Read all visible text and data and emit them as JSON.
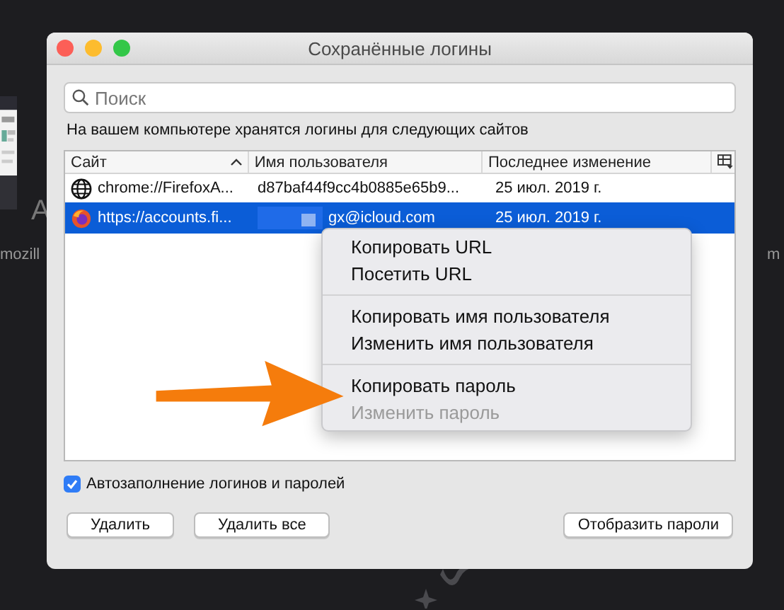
{
  "background": {
    "letter": "A",
    "left_label": "mozill",
    "right_label": "m"
  },
  "window": {
    "title": "Сохранённые логины"
  },
  "search": {
    "placeholder": "Поиск"
  },
  "info_text": "На вашем компьютере хранятся логины для следующих сайтов",
  "table": {
    "columns": [
      {
        "label": "Сайт",
        "sorted": true
      },
      {
        "label": "Имя пользователя",
        "sorted": false
      },
      {
        "label": "Последнее изменение",
        "sorted": false
      }
    ],
    "rows": [
      {
        "kind": "globe",
        "site": "chrome://FirefoxA...",
        "username": "d87baf44f9cc4b0885e65b9...",
        "changed": "25 июл. 2019 г.",
        "redacted": false,
        "selected": false
      },
      {
        "kind": "firefox",
        "site": "https://accounts.fi...",
        "username": "gx@icloud.com",
        "changed": "25 июл. 2019 г.",
        "redacted": true,
        "selected": true
      }
    ]
  },
  "context_menu": {
    "groups": [
      [
        {
          "label": "Копировать URL",
          "disabled": false
        },
        {
          "label": "Посетить URL",
          "disabled": false
        }
      ],
      [
        {
          "label": "Копировать имя пользователя",
          "disabled": false
        },
        {
          "label": "Изменить имя пользователя",
          "disabled": false
        }
      ],
      [
        {
          "label": "Копировать пароль",
          "disabled": false
        },
        {
          "label": "Изменить пароль",
          "disabled": true
        }
      ]
    ]
  },
  "autofill": {
    "label": "Автозаполнение логинов и паролей",
    "checked": true
  },
  "left_buttons": [
    "Удалить",
    "Удалить все"
  ],
  "right_buttons": [
    "Отобразить пароли"
  ]
}
